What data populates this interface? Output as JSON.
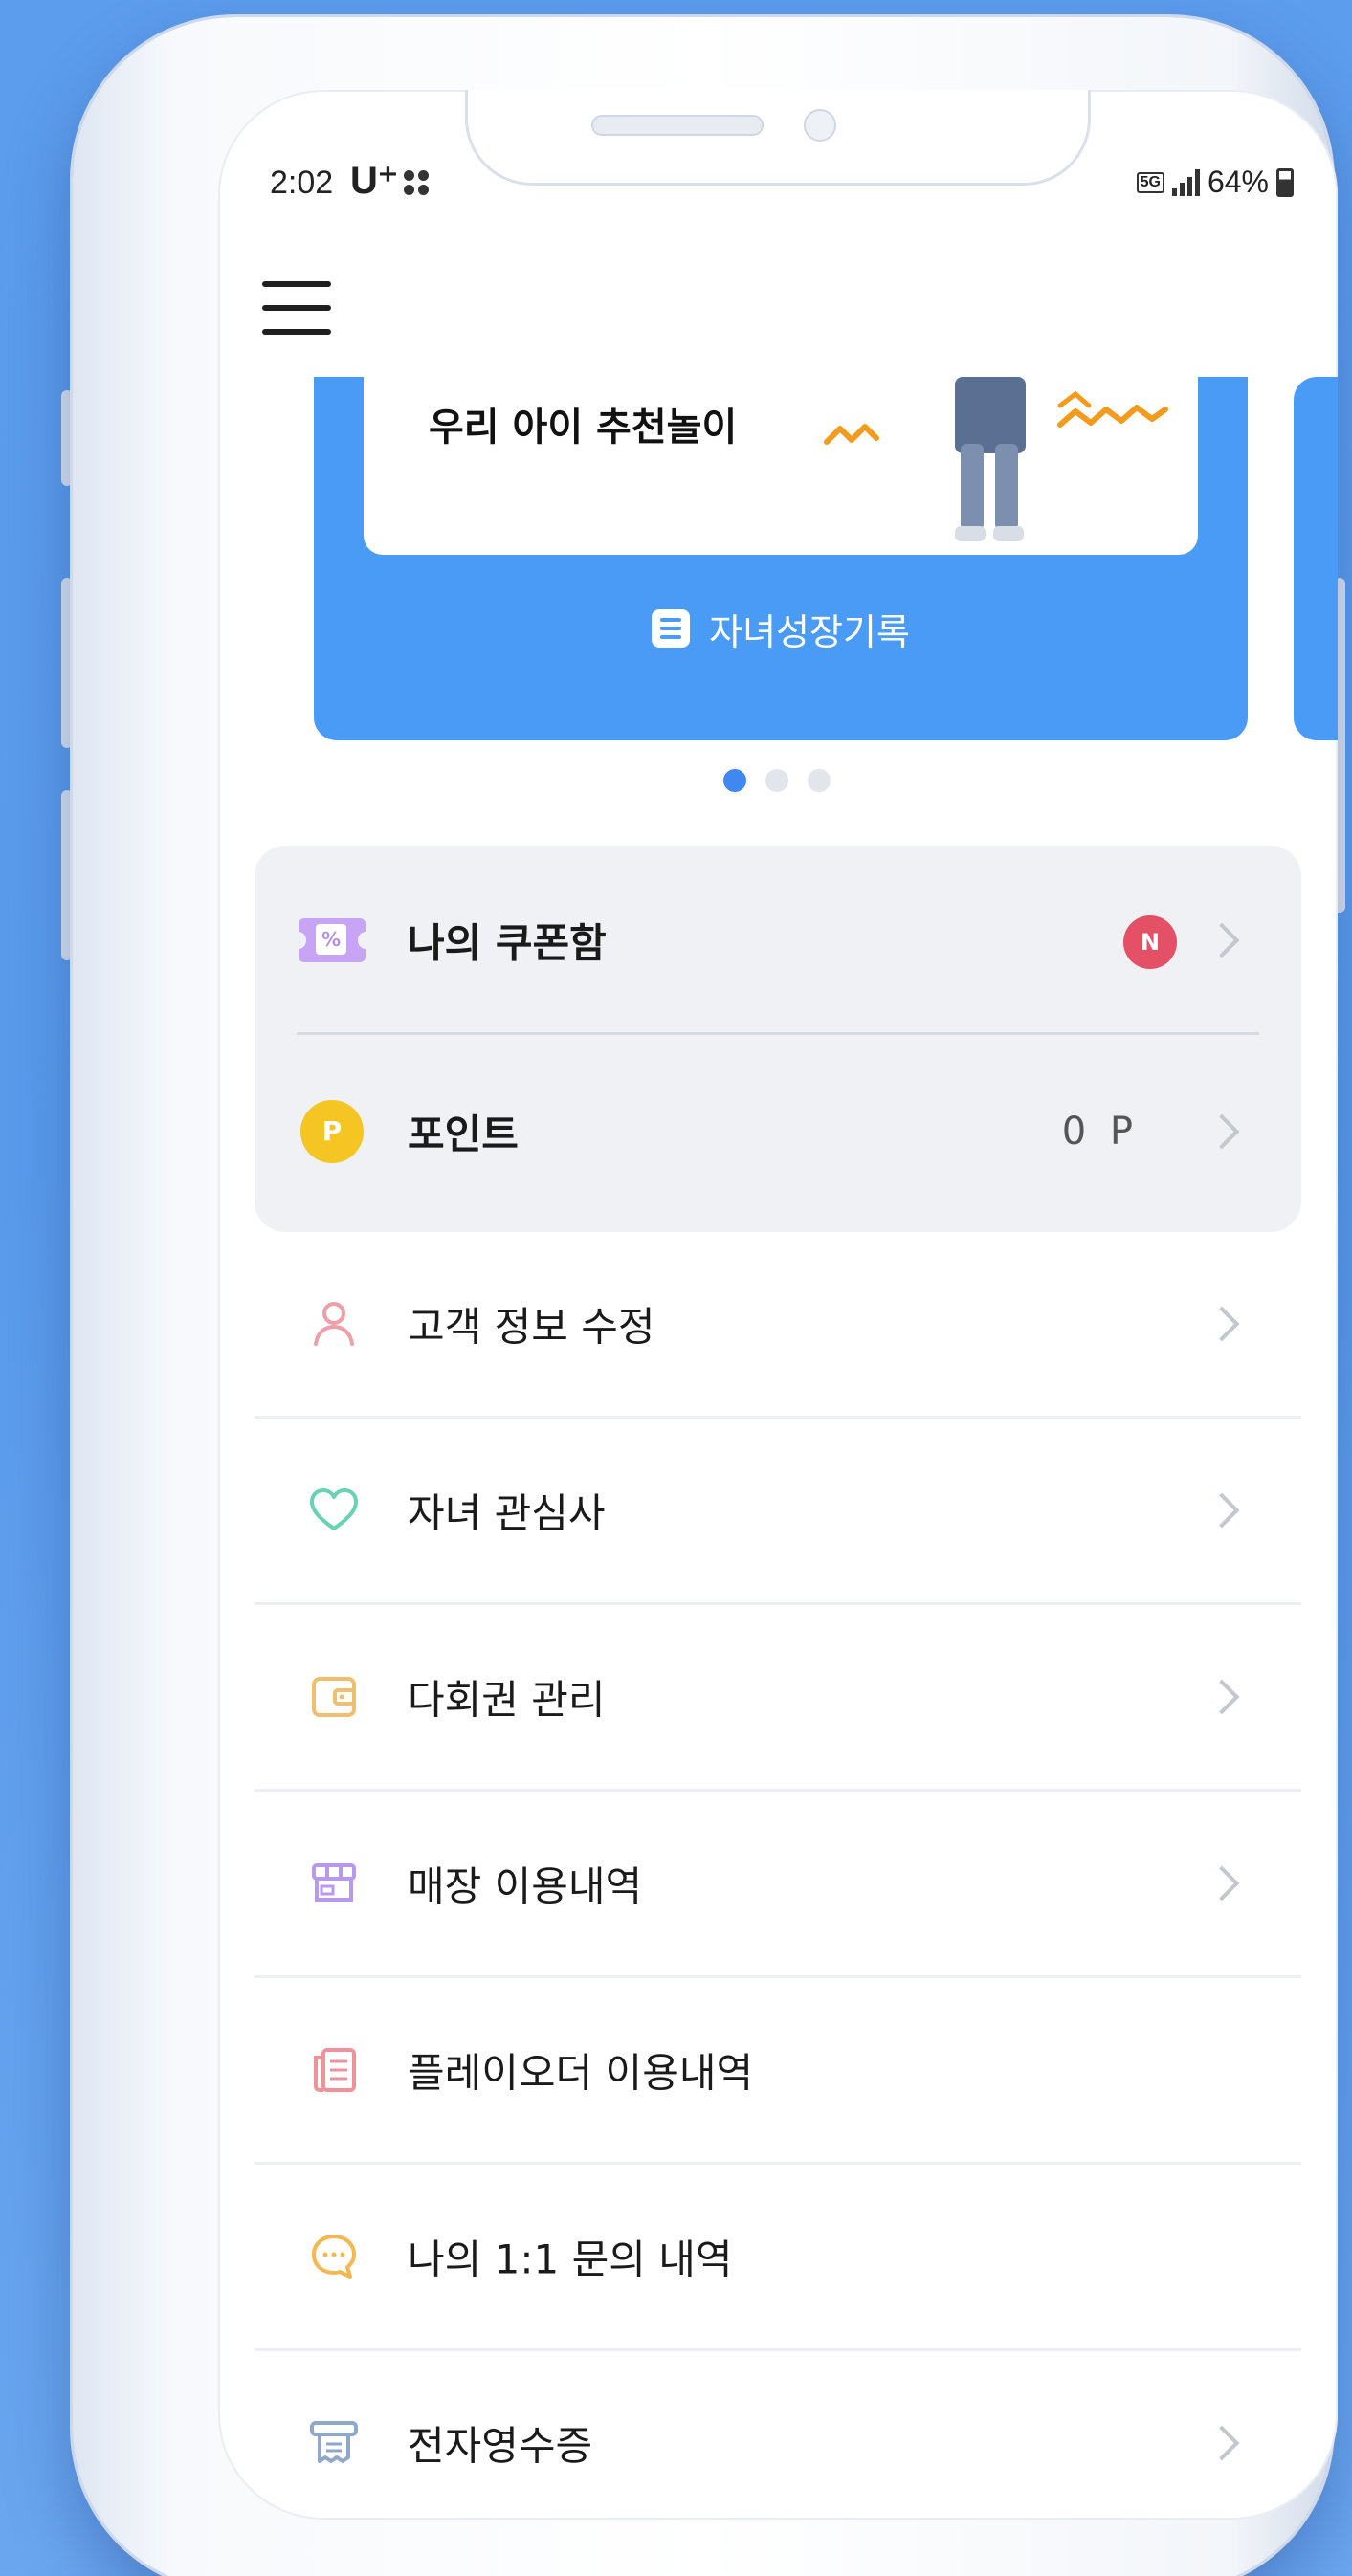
{
  "status_bar": {
    "time": "2:02",
    "carrier": "U⁺",
    "network": "5G",
    "battery": "64%"
  },
  "banner": {
    "card_text": "우리 아이 추천놀이",
    "button_label": "자녀성장기록",
    "page_count": 3,
    "active_page": 1,
    "color": "#4a9bf6"
  },
  "summary": {
    "coupon": {
      "label": "나의 쿠폰함",
      "badge": "N",
      "icon": "coupon-icon"
    },
    "point": {
      "label": "포인트",
      "value": "0 P",
      "icon_letter": "P",
      "icon": "point-icon"
    }
  },
  "menu": {
    "items": [
      {
        "label": "고객 정보 수정",
        "icon": "user-icon",
        "has_chevron": true
      },
      {
        "label": "자녀 관심사",
        "icon": "heart-icon",
        "has_chevron": true
      },
      {
        "label": "다회권 관리",
        "icon": "wallet-icon",
        "has_chevron": true
      },
      {
        "label": "매장 이용내역",
        "icon": "store-icon",
        "has_chevron": true
      },
      {
        "label": "플레이오더 이용내역",
        "icon": "order-icon",
        "has_chevron": false
      },
      {
        "label": "나의 1:1 문의 내역",
        "icon": "chat-icon",
        "has_chevron": false
      },
      {
        "label": "전자영수증",
        "icon": "receipt-icon",
        "has_chevron": true
      }
    ]
  }
}
